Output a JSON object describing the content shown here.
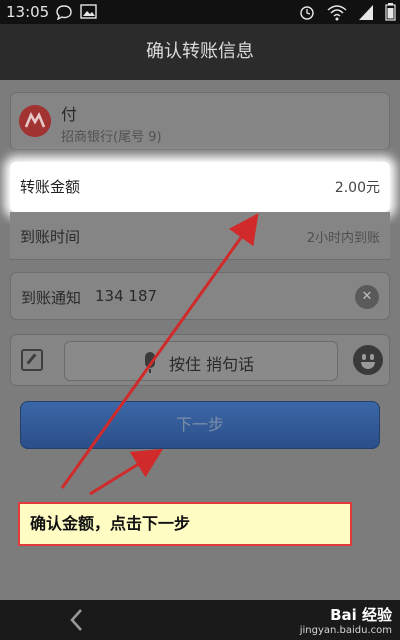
{
  "status_bar": {
    "time": "13:05"
  },
  "header": {
    "title": "确认转账信息"
  },
  "pay_card": {
    "label": "付",
    "bank": "招商银行(尾号        9)"
  },
  "amount_row": {
    "label": "转账金额",
    "value": "2.00元"
  },
  "time_row": {
    "label": "到账时间",
    "value": "2小时内到账"
  },
  "notify_row": {
    "label": "到账通知",
    "value": "134 187"
  },
  "voice": {
    "label": "按住 捎句话"
  },
  "next_button": {
    "label": "下一步"
  },
  "annotation": {
    "text": "确认金额，点击下一步"
  },
  "watermark": {
    "brand": "Bai 经验",
    "url": "jingyan.baidu.com"
  },
  "colors": {
    "accent_blue": "#2f5a97",
    "annotation_border": "#e13a3a",
    "annotation_bg": "#fffcc4",
    "arrow": "#d02a2a"
  },
  "icons": [
    "chat-bubble-icon",
    "image-icon",
    "alarm-icon",
    "wifi-icon",
    "signal-icon",
    "battery-icon",
    "bank-logo-icon",
    "clear-icon",
    "edit-icon",
    "mic-icon",
    "smile-icon",
    "back-icon"
  ]
}
